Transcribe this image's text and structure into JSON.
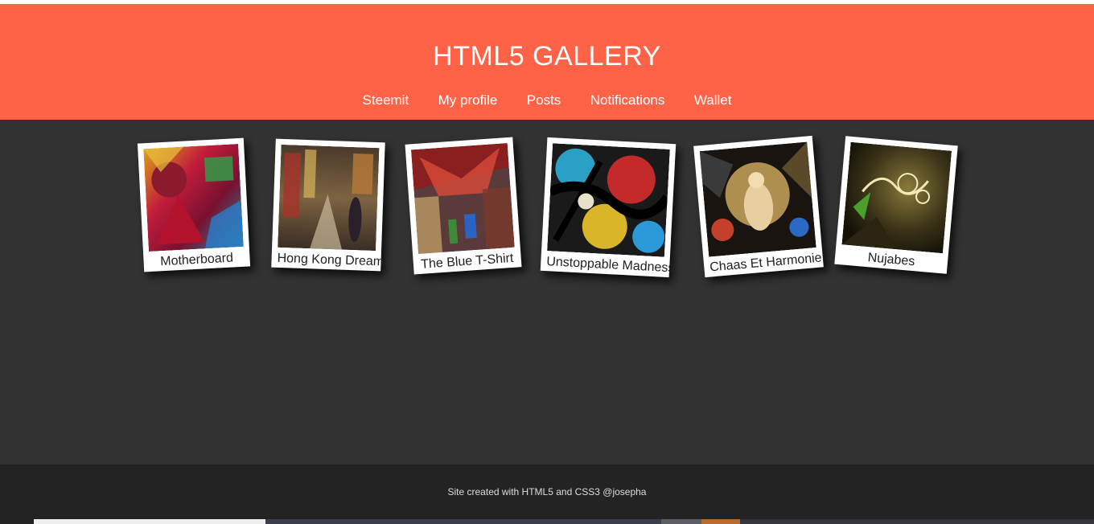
{
  "header": {
    "title": "HTML5 GALLERY",
    "nav": [
      "Steemit",
      "My profile",
      "Posts",
      "Notifications",
      "Wallet"
    ],
    "accent_color": "#ff6347"
  },
  "gallery": {
    "items": [
      {
        "caption": "Motherboard"
      },
      {
        "caption": "Hong Kong Dream"
      },
      {
        "caption": "The Blue T-Shirt"
      },
      {
        "caption": "Unstoppable Madness"
      },
      {
        "caption": "Chaas Et Harmonie"
      },
      {
        "caption": "Nujabes"
      }
    ]
  },
  "footer": {
    "text": "Site created with HTML5 and CSS3 @josepha"
  }
}
